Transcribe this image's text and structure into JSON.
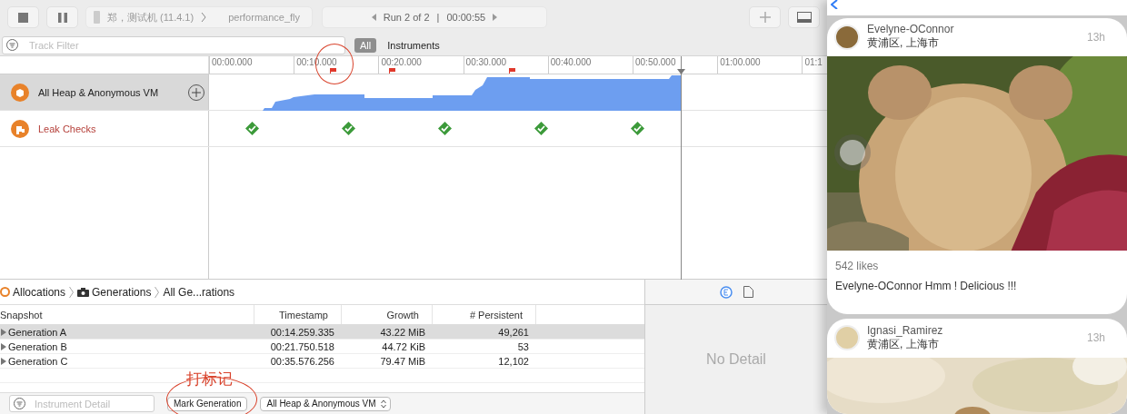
{
  "toolbar": {
    "device": "郑，测试机 (11.4.1)",
    "target": "performance_fly",
    "run": "Run 2 of 2",
    "separator": "|",
    "duration": "00:00:55"
  },
  "filter_bar": {
    "track_filter": {
      "placeholder": "Track Filter"
    },
    "scopes": [
      {
        "label": "All",
        "selected": true
      },
      {
        "label": "Instruments",
        "selected": false
      }
    ]
  },
  "ruler": {
    "ticks": [
      "00:00.000",
      "00:10.000",
      "00:20.000",
      "00:30.000",
      "00:40.000",
      "00:50.000",
      "01:00.000",
      "01:1"
    ]
  },
  "tracks": [
    {
      "kind": "allocations",
      "name": "All Heap & Anonymous VM",
      "selected": true
    },
    {
      "kind": "leaks",
      "name": "Leak Checks",
      "selected": false,
      "checks": [
        {
          "passed": true
        },
        {
          "passed": true
        },
        {
          "passed": true
        },
        {
          "passed": true
        },
        {
          "passed": true
        }
      ]
    }
  ],
  "breadcrumb": [
    "Allocations",
    "Generations",
    "All Ge...rations"
  ],
  "table": {
    "columns": [
      "Snapshot",
      "Timestamp",
      "Growth",
      "# Persistent"
    ],
    "rows": [
      {
        "cells": [
          "Generation A",
          "00:14.259.335",
          "43.22 MiB",
          "49,261"
        ],
        "selected": true
      },
      {
        "cells": [
          "Generation B",
          "00:21.750.518",
          "44.72 KiB",
          "53"
        ],
        "selected": false
      },
      {
        "cells": [
          "Generation C",
          "00:35.576.256",
          "79.47 MiB",
          "12,102"
        ],
        "selected": false
      }
    ]
  },
  "annotation": {
    "text": "打标记"
  },
  "bottom_bar": {
    "instrument_detail": {
      "placeholder": "Instrument Detail"
    },
    "mark_button": "Mark Generation",
    "track_select": "All Heap & Anonymous VM"
  },
  "detail_pane": {
    "message": "No Detail"
  },
  "phone_feed": {
    "posts": [
      {
        "user": "Evelyne-OConnor",
        "location": "黄浦区, 上海市",
        "time": "13h",
        "likes": "542 likes",
        "comment": "Evelyne-OConnor Hmm ! Delicious !!!"
      },
      {
        "user": "Ignasi_Ramirez",
        "location": "黄浦区, 上海市",
        "time": "13h"
      }
    ]
  }
}
